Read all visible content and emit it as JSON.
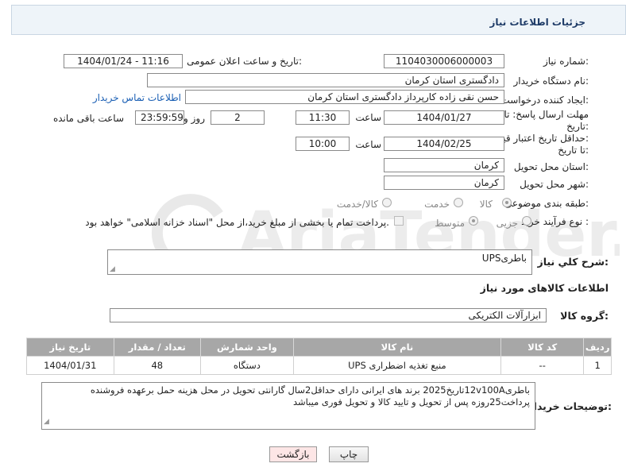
{
  "panel": {
    "title": "جزئیات اطلاعات نیاز"
  },
  "fields": {
    "need_number_label": "شماره نیاز:",
    "need_number": "1104030006000003",
    "announce_label": "تاریخ و ساعت اعلان عمومی:",
    "announce_value": "1404/01/24 - 11:16",
    "buyer_org_label": "نام دستگاه خریدار:",
    "buyer_org": "دادگستری استان کرمان",
    "creator_label": "ایجاد کننده درخواست:",
    "creator": "حسن نقی زاده کارپرداز دادگستری استان کرمان",
    "contact_link": "اطلاعات تماس خریدار",
    "deadline_label_1": "مهلت ارسال پاسخ: تا",
    "deadline_label_2": "تاریخ:",
    "deadline_date": "1404/01/27",
    "time_label": "ساعت",
    "deadline_time": "11:30",
    "days_value": "2",
    "days_label": "روز و",
    "remaining_time": "23:59:59",
    "remaining_label": "ساعت باقی مانده",
    "validity_label_1": "حداقل تاریخ اعتبار قیمت:",
    "validity_label_2": "تا تاریخ:",
    "validity_date": "1404/02/25",
    "validity_time": "10:00",
    "province_label": "استان محل تحویل:",
    "province": "کرمان",
    "city_label": "شهر محل تحویل:",
    "city": "کرمان",
    "category_label": "طبقه بندی موضوعی:",
    "category_options": [
      "کالا",
      "خدمت",
      "کالا/خدمت"
    ],
    "category_selected": "کالا",
    "process_label": "نوع فرآیند خرید :",
    "process_options": [
      "جزیی",
      "متوسط"
    ],
    "process_selected": "جزیی",
    "payment_note": "پرداخت تمام یا بخشی از مبلغ خرید،از محل \"اسناد خزانه اسلامی\" خواهد بود."
  },
  "summary": {
    "label": "شرح کلي نياز:",
    "value": "باطریUPS"
  },
  "goods_section": {
    "title": "اطلاعات کالاهای مورد نیاز",
    "group_label": "گروه کالا:",
    "group_value": "ابزارآلات الکتریکی"
  },
  "table": {
    "headers": [
      "ردیف",
      "کد کالا",
      "نام کالا",
      "واحد شمارش",
      "تعداد / مقدار",
      "تاریخ نیاز"
    ],
    "rows": [
      [
        "1",
        "--",
        "منبع تغذیه اضطراری UPS",
        "دستگاه",
        "48",
        "1404/01/31"
      ]
    ]
  },
  "buyer_notes": {
    "label": "توضیحات خریدار:",
    "line1": "باطری12v100Aتاریخ2025 برند های ایرانی دارای حداقل2سال گارانتی تحویل در محل هزینه حمل برعهده فروشنده",
    "line2": "پرداخت25روزه پس از تحویل و تایید کالا و تحویل فوری میباشد"
  },
  "buttons": {
    "print": "چاپ",
    "back": "بازگشت"
  },
  "watermark": {
    "text": "AriaTender.neT"
  },
  "colors": {
    "accent": "#1f3c68",
    "link": "#1a5fb4",
    "table_header": "#a7a7a7",
    "back_button_bg": "#fde6e6"
  }
}
